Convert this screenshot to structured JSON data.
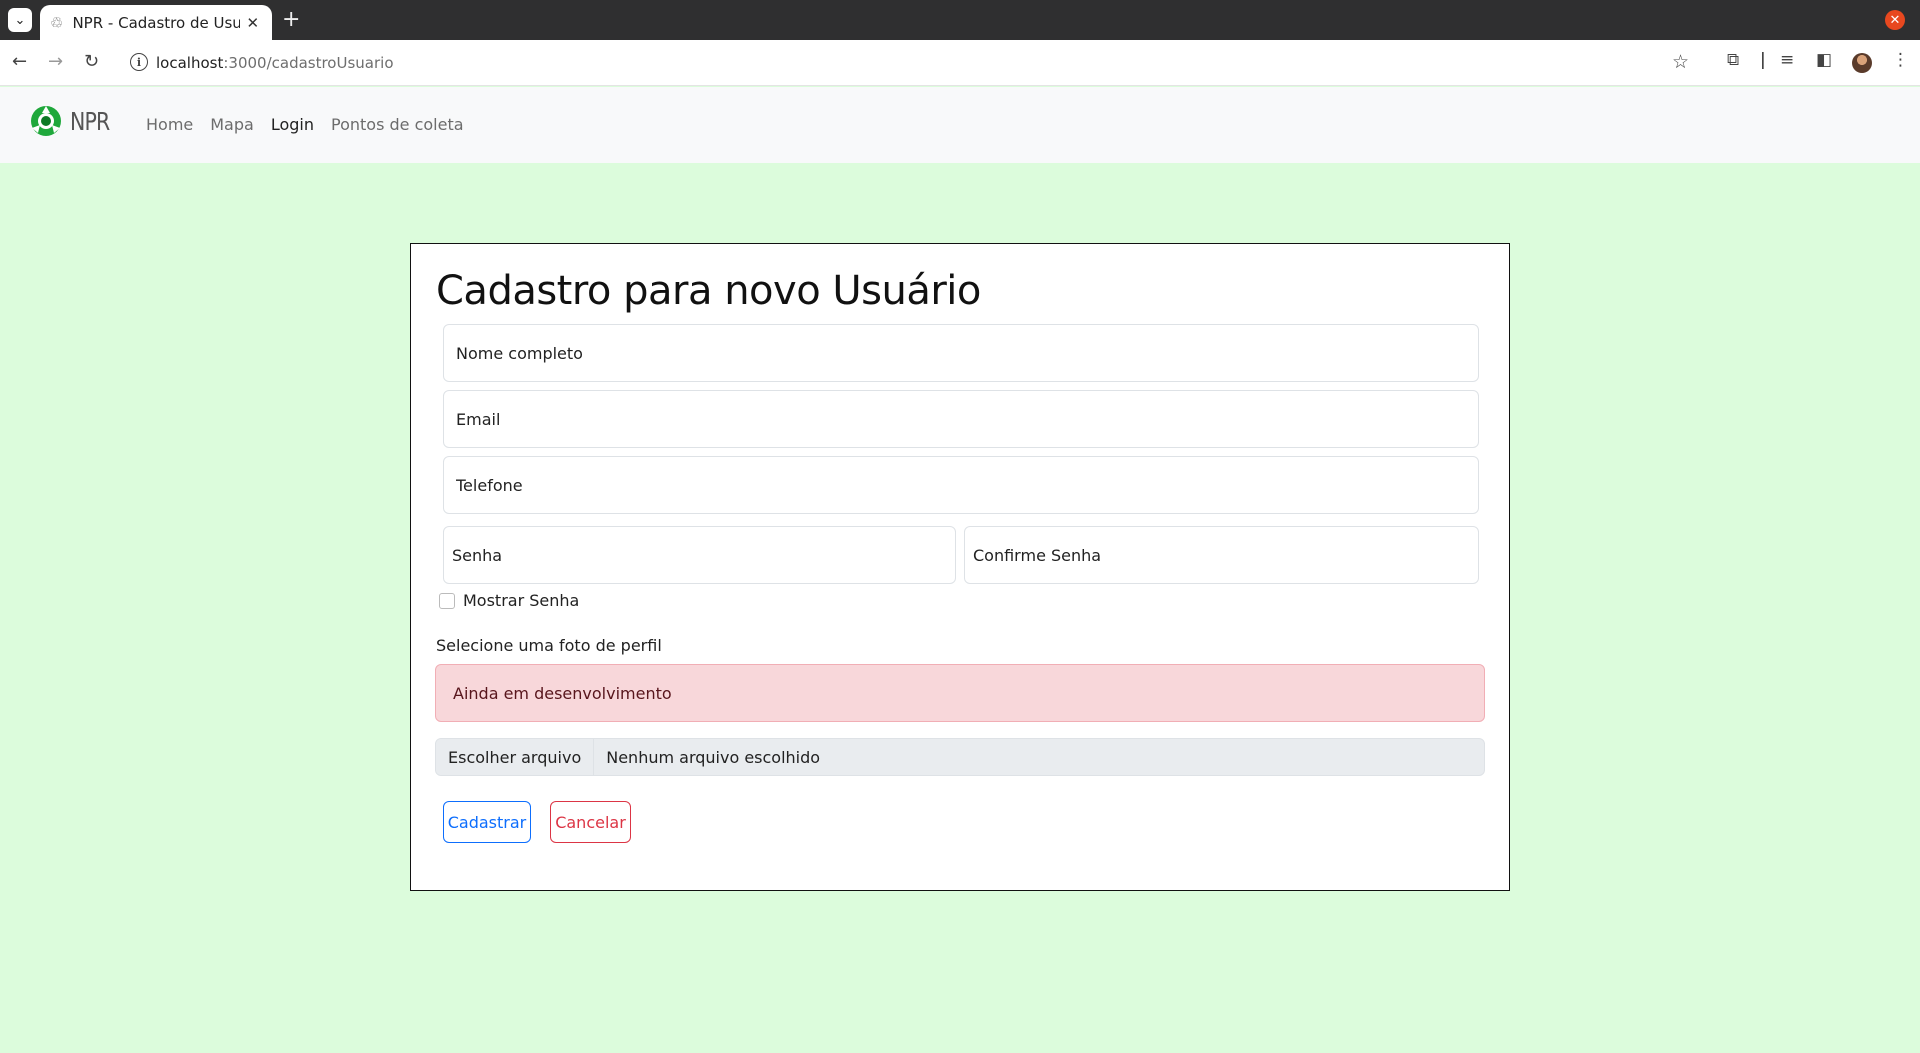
{
  "browser": {
    "tab_title": "NPR - Cadastro de Usuario",
    "url_host": "localhost",
    "url_path": ":3000/cadastroUsuario",
    "icons": [
      "tab-search-icon",
      "recycle-icon",
      "close-icon",
      "plus-icon",
      "back-icon",
      "forward-icon",
      "reload-icon",
      "info-icon",
      "star-icon",
      "extensions-icon",
      "media-icon",
      "sidepanel-icon",
      "menu-icon"
    ]
  },
  "navbar": {
    "brand": "NPR",
    "links": [
      {
        "label": "Home",
        "active": false
      },
      {
        "label": "Mapa",
        "active": false
      },
      {
        "label": "Login",
        "active": true
      },
      {
        "label": "Pontos de coleta",
        "active": false
      }
    ]
  },
  "form": {
    "title": "Cadastro para novo Usuário",
    "name_placeholder": "Nome completo",
    "email_placeholder": "Email",
    "phone_placeholder": "Telefone",
    "password_placeholder": "Senha",
    "confirm_password_placeholder": "Confirme Senha",
    "show_password_label": "Mostrar Senha",
    "photo_label": "Selecione uma foto de perfil",
    "alert_text": "Ainda em desenvolvimento",
    "file_button": "Escolher arquivo",
    "file_status": "Nenhum arquivo escolhido",
    "submit_label": "Cadastrar",
    "cancel_label": "Cancelar"
  },
  "colors": {
    "page_background": "#dcfcdc",
    "primary": "#0d6efd",
    "danger": "#dc3545",
    "alert_background": "#f8d7da"
  }
}
